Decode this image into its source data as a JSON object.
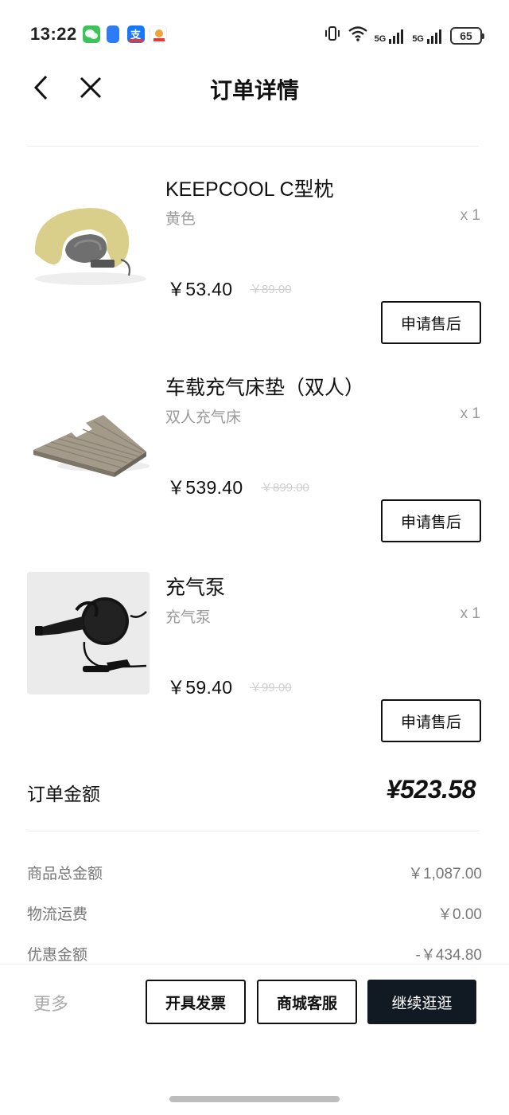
{
  "status_bar": {
    "time": "13:22",
    "network_1": "5G",
    "network_2": "5G",
    "battery": "65",
    "icons": [
      "wechat-icon",
      "app-icon",
      "alipay-icon",
      "app-icon",
      "vibrate-icon",
      "wifi-icon",
      "signal-icon",
      "signal-icon",
      "battery-icon"
    ]
  },
  "header": {
    "title": "订单详情",
    "back_icon": "chevron-left-icon",
    "close_icon": "close-icon"
  },
  "products": [
    {
      "name": "KEEPCOOL C型枕",
      "variant": "黄色",
      "qty": "x 1",
      "price": "￥53.40",
      "original_price": "￥89.00",
      "action": "申请售后"
    },
    {
      "name": "车载充气床垫（双人）",
      "variant": "双人充气床",
      "qty": "x 1",
      "price": "￥539.40",
      "original_price": "￥899.00",
      "action": "申请售后"
    },
    {
      "name": "充气泵",
      "variant": "充气泵",
      "qty": "x 1",
      "price": "￥59.40",
      "original_price": "￥99.00",
      "action": "申请售后"
    }
  ],
  "order_total": {
    "label": "订单金额",
    "value": "¥523.58"
  },
  "summary": [
    {
      "label": "商品总金额",
      "value": "￥1,087.00"
    },
    {
      "label": "物流运费",
      "value": "￥0.00"
    },
    {
      "label": "优惠金额",
      "value": "-￥434.80"
    }
  ],
  "bottom_bar": {
    "more": "更多",
    "invoice": "开具发票",
    "service": "商城客服",
    "continue": "继续逛逛"
  },
  "colors": {
    "primary_dark": "#111a22",
    "muted_text": "#9a9a9a",
    "strike_price": "#cfcfcf",
    "divider": "#ececec"
  }
}
